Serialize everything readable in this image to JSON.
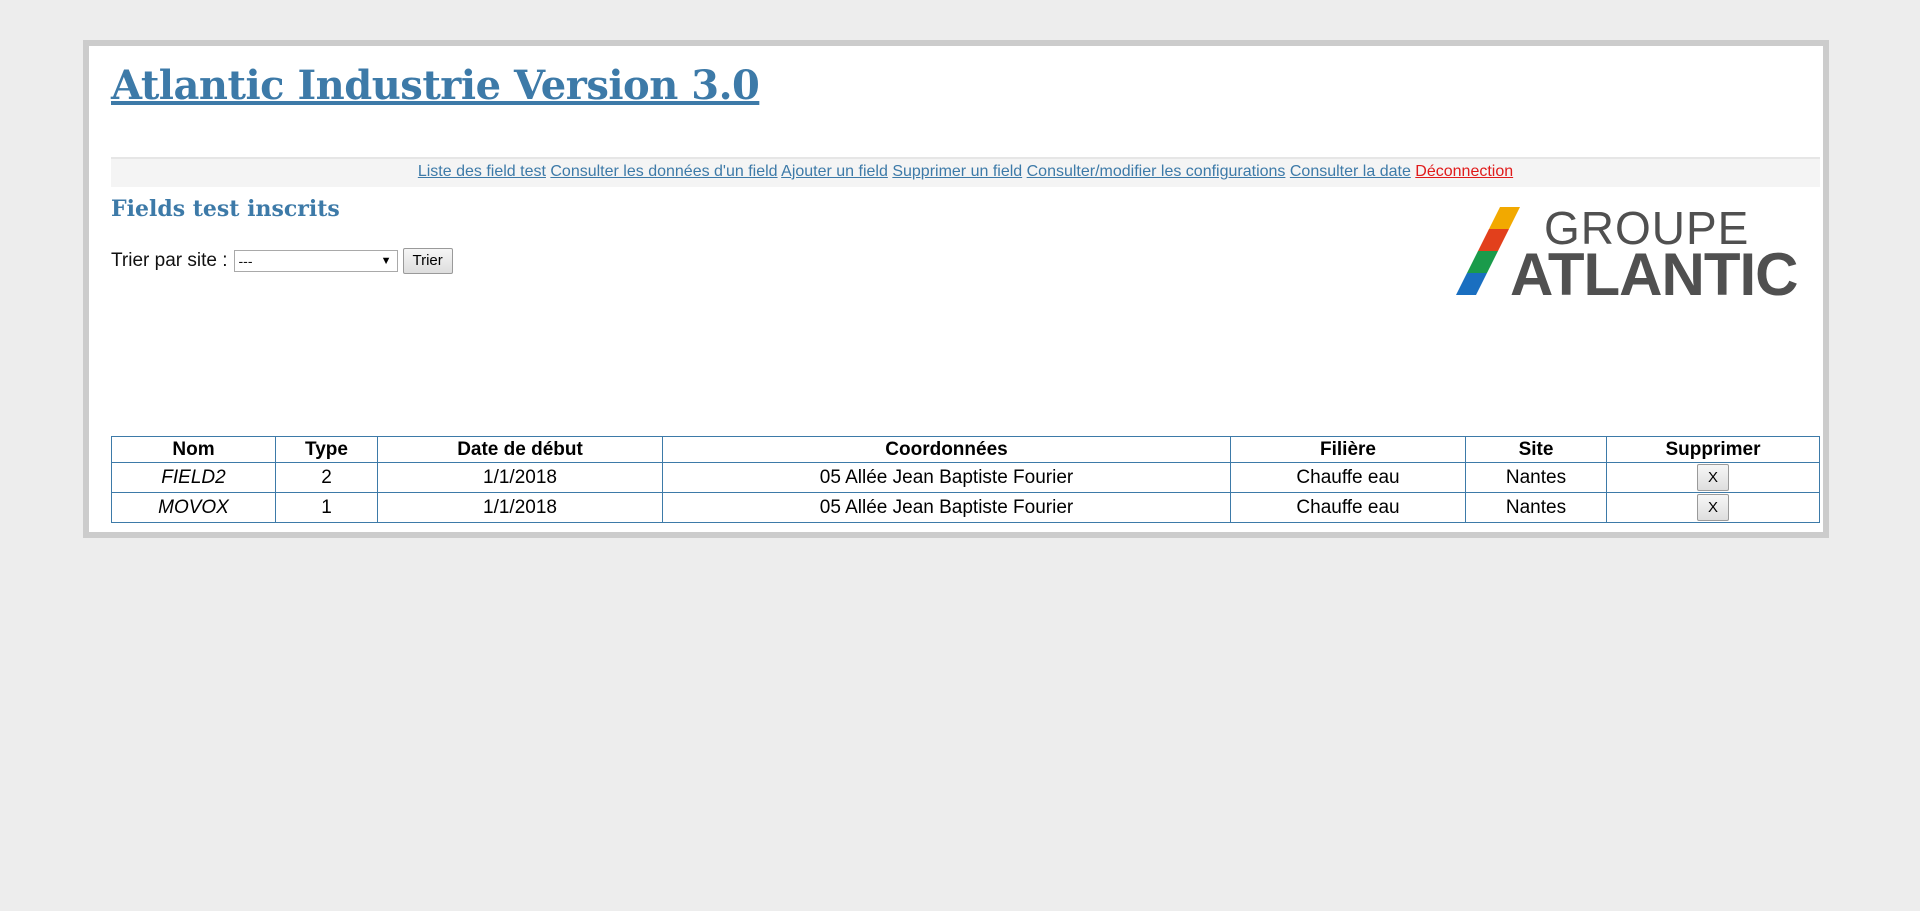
{
  "app": {
    "title": "Atlantic Industrie Version 3.0"
  },
  "nav": {
    "items": [
      {
        "label": "Liste des field test"
      },
      {
        "label": "Consulter les données d'un field"
      },
      {
        "label": "Ajouter un field"
      },
      {
        "label": "Supprimer un field"
      },
      {
        "label": "Consulter/modifier les configurations"
      },
      {
        "label": "Consulter la date"
      },
      {
        "label": "Déconnection"
      }
    ]
  },
  "section": {
    "title": "Fields test inscrits"
  },
  "filter": {
    "label": "Trier par site :",
    "selected": "---",
    "button_label": "Trier"
  },
  "logo": {
    "line1": "GROUPE",
    "line2": "ATLANTIC",
    "stripe_colors": [
      "#f2a900",
      "#e2401c",
      "#1a9b4b",
      "#1a6fc0"
    ],
    "text_color": "#505050"
  },
  "table": {
    "columns": [
      "Nom",
      "Type",
      "Date de début",
      "Coordonnées",
      "Filière",
      "Site",
      "Supprimer"
    ],
    "rows": [
      {
        "nom": "FIELD2",
        "type": "2",
        "date": "1/1/2018",
        "coord": "05 Allée Jean Baptiste Fourier",
        "filiere": "Chauffe eau",
        "site": "Nantes",
        "delete_label": "X"
      },
      {
        "nom": "MOVOX",
        "type": "1",
        "date": "1/1/2018",
        "coord": "05 Allée Jean Baptiste Fourier",
        "filiere": "Chauffe eau",
        "site": "Nantes",
        "delete_label": "X"
      }
    ]
  },
  "colors": {
    "accent": "#3d7aa8",
    "logout": "#e01b1b",
    "background": "#ededed"
  }
}
